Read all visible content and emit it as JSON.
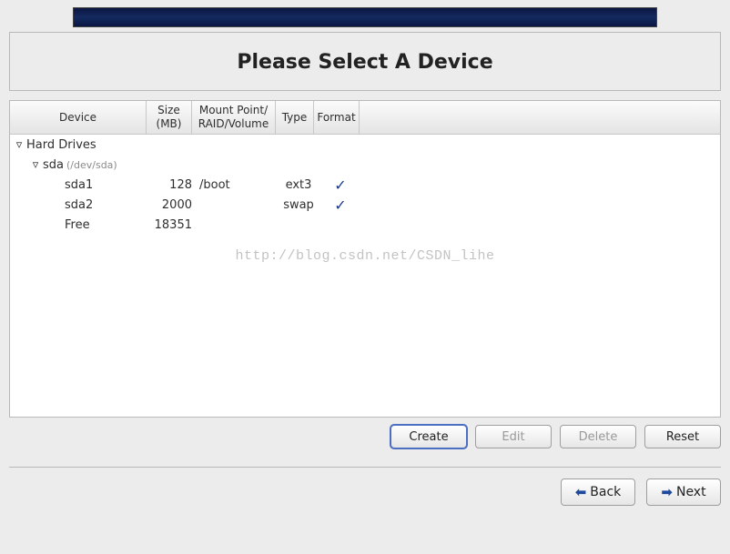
{
  "header": {
    "title": "Please Select A Device"
  },
  "columns": {
    "device": "Device",
    "size": "Size\n(MB)",
    "mount": "Mount Point/\nRAID/Volume",
    "type": "Type",
    "format": "Format"
  },
  "tree": {
    "root_label": "Hard Drives",
    "disk": {
      "name": "sda",
      "path": "(/dev/sda)"
    },
    "partitions": [
      {
        "name": "sda1",
        "size": "128",
        "mount": "/boot",
        "type": "ext3",
        "format": true
      },
      {
        "name": "sda2",
        "size": "2000",
        "mount": "",
        "type": "swap",
        "format": true
      },
      {
        "name": "Free",
        "size": "18351",
        "mount": "",
        "type": "",
        "format": false
      }
    ]
  },
  "buttons": {
    "create": "Create",
    "edit": "Edit",
    "delete": "Delete",
    "reset": "Reset",
    "back": "Back",
    "next": "Next"
  },
  "watermark": "http://blog.csdn.net/CSDN_lihe"
}
